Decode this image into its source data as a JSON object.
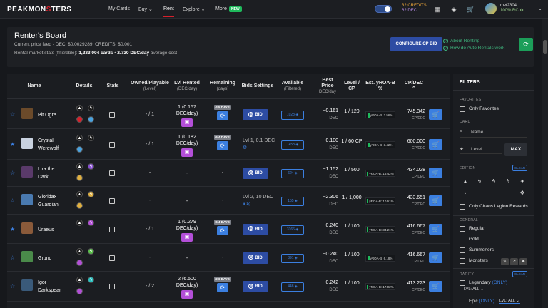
{
  "nav": {
    "logo_a": "PEAKMON",
    "logo_x": "S",
    "logo_b": "TERS",
    "items": [
      "My Cards",
      "Buy ⌄",
      "Rent",
      "Explore ⌄",
      "More"
    ],
    "new_badge": "NEW",
    "credits": "32 CREDITS",
    "dec": "62 DEC",
    "username": "mvt2304",
    "rc": "100% RC ⚙"
  },
  "board": {
    "title": "Renter's Board",
    "price_feed": "Current price feed - DEC: $0.0029289, CREDITS: $0.001",
    "stats_prefix": "Rental market stats (filterable): ",
    "cards": "1,233,004 cards",
    "sep": " • ",
    "dec_day": "2.730 DEC/day",
    "avg": " average cost",
    "configure_btn": "CONFIGURE CP BID",
    "link_about": "About Renting",
    "link_auto": "How do Auto Rentals work"
  },
  "headers": {
    "name": "Name",
    "details": "Details",
    "stats": "Stats",
    "owned": "Owned/Playable",
    "owned_sub": "(Level)",
    "lvl_rented": "Lvl Rented",
    "lvl_rented_sub": "(DEC/day)",
    "remaining": "Remaining",
    "remaining_sub": "(days)",
    "bids": "Bids Settings",
    "available": "Available",
    "available_sub": "(Filtered)",
    "best_price": "Best",
    "best_price2": "Price",
    "best_price_sub": "DEC/day",
    "level_cp": "Level /",
    "level_cp2": "CP",
    "yroa": "Est. yROA-B",
    "yroa2": "%",
    "cpdec": "CP/DEC",
    "cpdec_arrow": "⌃"
  },
  "rows": [
    {
      "name1": "Pit Ogre",
      "name2": "",
      "starred": false,
      "owned": "- / 1",
      "rented1": "1 (0.157",
      "rented2": "DEC/day)",
      "days": "4.5 DAYS",
      "bid": "BID",
      "bidtext1": "",
      "bidtext2": "",
      "avail": "1028",
      "price": "−0.161",
      "price_u": "DEC",
      "lvlcp": "1 / 120",
      "yroa": "yROA-B: 2.56%",
      "cpdec": "745.342",
      "cpdec_u": "CP/DEC",
      "img": "#6b4a2a",
      "a1": "#1a1a1a",
      "a2": "#1a1a1a",
      "a3": "#d6202b",
      "a4": "#4aa3e0"
    },
    {
      "name1": "Crystal",
      "name2": "Werewolf",
      "starred": true,
      "owned": "- / 1",
      "rented1": "1 (0.182",
      "rented2": "DEC/day)",
      "days": "6.4 DAYS",
      "bid": "",
      "bidtext1": "Lvl 1, 0.1 DEC",
      "bidtext2": "⚙",
      "avail": "1458",
      "price": "−0.100",
      "price_u": "DEC",
      "lvlcp": "1 / 60 CP",
      "yroa": "yROA-B: 3.42%",
      "cpdec": "600.000",
      "cpdec_u": "CP/DEC",
      "img": "#c9d2e0",
      "a1": "#1a1a1a",
      "a2": "#1a1a1a",
      "a3": "#4aa3e0",
      "a4": ""
    },
    {
      "name1": "Lira the",
      "name2": "Dark",
      "starred": false,
      "owned": "-",
      "rented1": "-",
      "rented2": "",
      "days": "",
      "bid": "BID",
      "bidtext1": "",
      "bidtext2": "",
      "avail": "624",
      "price": "−1.152",
      "price_u": "DEC",
      "lvlcp": "1 / 500",
      "yroa": "yROA-B: 16.42%",
      "cpdec": "434.028",
      "cpdec_u": "CP/DEC",
      "img": "#5a3a6a",
      "a1": "#1a1a1a",
      "a2": "#8a4fd8",
      "a3": "#e0b040",
      "a4": ""
    },
    {
      "name1": "Gloridax",
      "name2": "Guardian",
      "starred": false,
      "owned": "-",
      "rented1": "-",
      "rented2": "",
      "days": "",
      "bid": "",
      "bidtext1": "Lvl 2, 10 DEC",
      "bidtext2": "⏸ ⚙",
      "avail": "155",
      "price": "−2.306",
      "price_u": "DEC",
      "lvlcp": "1 / 1,000",
      "yroa": "yROA-B: 10.61%",
      "cpdec": "433.651",
      "cpdec_u": "CP/DEC",
      "img": "#4a7ab0",
      "a1": "#1a1a1a",
      "a2": "#e0b040",
      "a3": "#e0b040",
      "a4": ""
    },
    {
      "name1": "Uraeus",
      "name2": "",
      "starred": true,
      "owned": "- / 1",
      "rented1": "1 (0.279",
      "rented2": "DEC/day)",
      "days": "6.4 DAYS",
      "bid": "BID",
      "bidtext1": "",
      "bidtext2": "",
      "avail": "3166",
      "price": "−0.240",
      "price_u": "DEC",
      "lvlcp": "1 / 100",
      "yroa": "yROA-B: 34.21%",
      "cpdec": "416.667",
      "cpdec_u": "CP/DEC",
      "img": "#8a5a3a",
      "a1": "#1a1a1a",
      "a2": "#b34fd8",
      "a3": "",
      "a4": ""
    },
    {
      "name1": "Grund",
      "name2": "",
      "starred": false,
      "owned": "-",
      "rented1": "-",
      "rented2": "",
      "days": "",
      "bid": "BID",
      "bidtext1": "",
      "bidtext2": "",
      "avail": "891",
      "price": "−0.240",
      "price_u": "DEC",
      "lvlcp": "1 / 100",
      "yroa": "yROA-B: 6.18%",
      "cpdec": "416.667",
      "cpdec_u": "CP/DEC",
      "img": "#4a8a4a",
      "a1": "#1a1a1a",
      "a2": "#5ac04a",
      "a3": "#b34fd8",
      "a4": ""
    },
    {
      "name1": "Igor",
      "name2": "Darkspear",
      "starred": false,
      "owned": "- / 2",
      "rented1": "2 (6.500",
      "rented2": "DEC/day)",
      "days": "2.6 DAYS",
      "bid": "BID",
      "bidtext1": "",
      "bidtext2": "",
      "avail": "448",
      "price": "−0.242",
      "price_u": "DEC",
      "lvlcp": "1 / 100",
      "yroa": "yROA-B: 17.02%",
      "cpdec": "413.223",
      "cpdec_u": "CP/DEC",
      "img": "#3a5a7a",
      "a1": "#1a1a1a",
      "a2": "#2ac0c0",
      "a3": "#b34fd8",
      "a4": ""
    }
  ],
  "filters": {
    "title": "FILTERS",
    "favorites": "FAVORITES",
    "only_favorites": "Only Favorites",
    "card": "CARD",
    "name_ph": "Name",
    "level_ph": "Level",
    "max": "MAX",
    "edition": "EDITION",
    "clear": "CLEAR",
    "only_chaos": "Only Chaos Legion Rewards",
    "general": "GENERAL",
    "regular": "Regular",
    "gold": "Gold",
    "summoners": "Summoners",
    "monsters": "Monsters",
    "rarity": "RARITY",
    "legendary": "Legendary",
    "only": "(ONLY)",
    "lvl_all": "LVL: ALL ⌄",
    "epic": "Epic"
  },
  "colors": {
    "accent": "#3b7fe0",
    "brand_red": "#d6202b",
    "green": "#1c9e59",
    "purple": "#b34fd8"
  }
}
